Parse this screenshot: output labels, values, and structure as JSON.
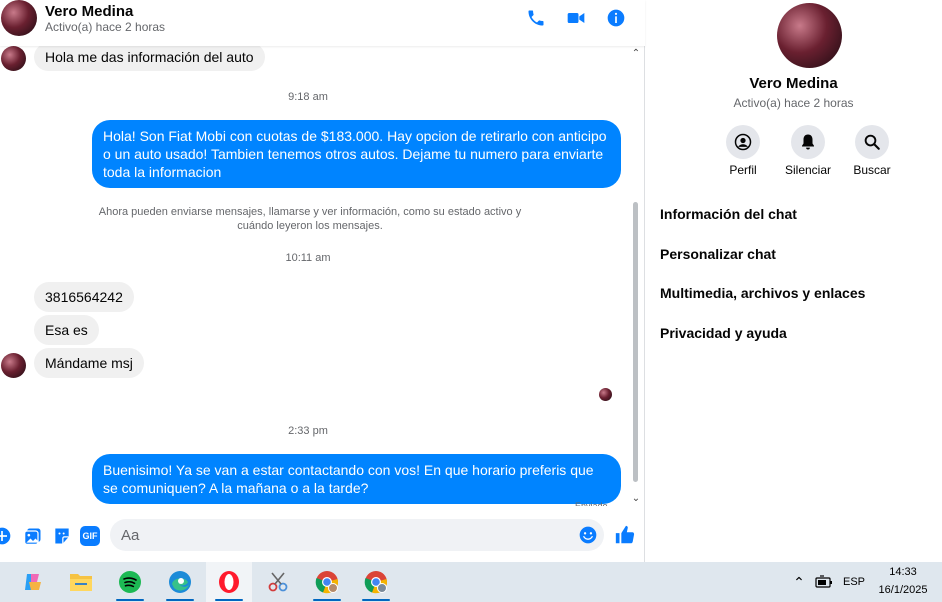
{
  "header": {
    "name": "Vero Medina",
    "status": "Activo(a) hace 2 horas"
  },
  "messages": {
    "first_in": "Hola me das información del auto",
    "ts1": "9:18 am",
    "out1": "Hola! Son Fiat Mobi con cuotas de $183.000. Hay opcion de retirarlo con anticipo o un auto usado! Tambien tenemos otros autos. Dejame tu numero para enviarte toda la informacion",
    "system": "Ahora pueden enviarse mensajes, llamarse y ver información, como su estado activo y cuándo leyeron los mensajes.",
    "ts2": "10:11 am",
    "in_phone": "3816564242",
    "in_esa": "Esa es",
    "in_mandame": "Mándame msj",
    "ts3": "2:33 pm",
    "out2": "Buenisimo! Ya se van a estar contactando con vos! En que horario preferis que se comuniquen? A la mañana o a la tarde?",
    "cut_text": "Enviado"
  },
  "composer": {
    "placeholder": "Aa",
    "gif_label": "GIF"
  },
  "info": {
    "name": "Vero Medina",
    "status": "Activo(a) hace 2 horas",
    "actions": [
      {
        "label": "Perfil",
        "icon": "profile-icon"
      },
      {
        "label": "Silenciar",
        "icon": "bell-icon"
      },
      {
        "label": "Buscar",
        "icon": "search-icon"
      }
    ],
    "items": [
      "Información del chat",
      "Personalizar chat",
      "Multimedia, archivos y enlaces",
      "Privacidad y ayuda"
    ]
  },
  "taskbar": {
    "lang": "ESP",
    "time": "14:33",
    "date": "16/1/2025"
  },
  "colors": {
    "accent": "#0084ff",
    "icon_blue": "#0a7cff"
  }
}
